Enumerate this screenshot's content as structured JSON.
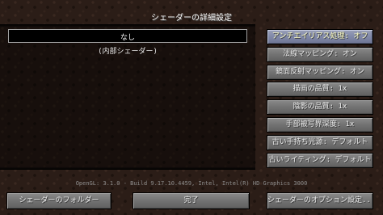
{
  "screen": {
    "title": "シェーダーの詳細設定"
  },
  "shader_list": {
    "items": [
      {
        "name": "なし",
        "subtitle": "(内部シェーダー)",
        "selected": true
      }
    ]
  },
  "options": [
    {
      "label": "アンチエイリアス処理: オフ",
      "selected": true
    },
    {
      "label": "法線マッピング: オン",
      "selected": false
    },
    {
      "label": "鏡面反射マッピング: オン",
      "selected": false
    },
    {
      "label": "描画の品質: 1x",
      "selected": false
    },
    {
      "label": "陰影の品質: 1x",
      "selected": false
    },
    {
      "label": "手部被写界深度: 1x",
      "selected": false
    },
    {
      "label": "古い手持ち光源: デフォルト",
      "selected": false
    },
    {
      "label": "古いライティング: デフォルト",
      "selected": false
    }
  ],
  "info_line": "OpenGL: 3.1.0 - Build 9.17.10.4459, Intel, Intel(R) HD Graphics 3000",
  "bottom_buttons": {
    "shader_folder": "シェーダーのフォルダー",
    "done": "完了",
    "shader_options": "シェーダーのオプション設定..."
  }
}
